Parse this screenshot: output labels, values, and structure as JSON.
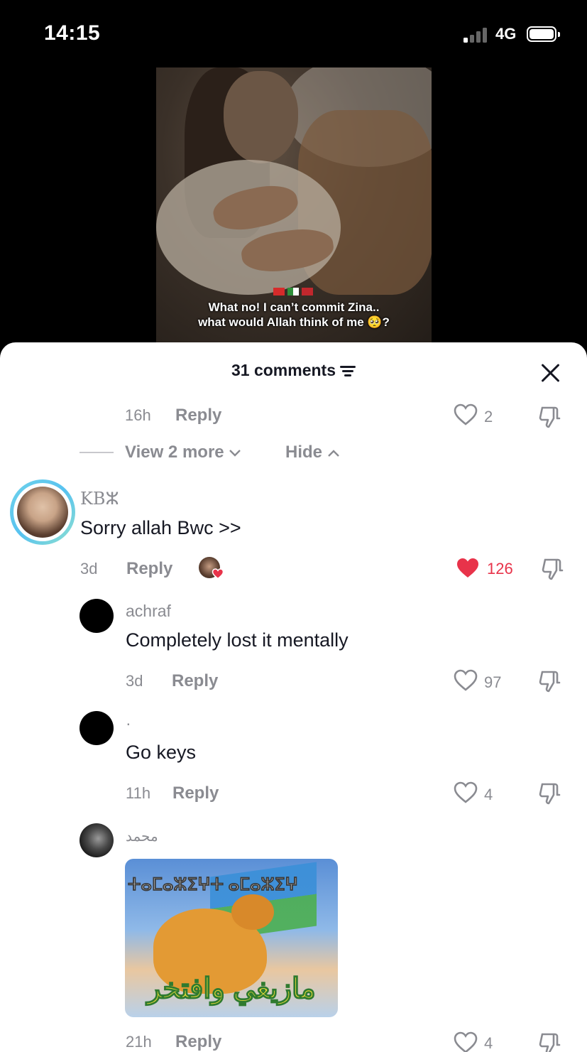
{
  "status_bar": {
    "time": "14:15",
    "network": "4G"
  },
  "video": {
    "caption_line1": "What no! I can’t commit Zina..",
    "caption_line2": "what would Allah think of me 🥺?"
  },
  "sheet": {
    "title": "31 comments"
  },
  "thread0": {
    "time": "16h",
    "reply": "Reply",
    "likes": "2",
    "view_more": "View 2 more",
    "hide": "Hide"
  },
  "comments": [
    {
      "username": "KBⵣ",
      "text": "Sorry allah Bwc >>",
      "time": "3d",
      "reply": "Reply",
      "likes": "126",
      "liked": true
    },
    {
      "username": "achraf",
      "text": "Completely lost it mentally",
      "time": "3d",
      "reply": "Reply",
      "likes": "97"
    },
    {
      "username": "·",
      "text": "Go keys",
      "time": "11h",
      "reply": "Reply",
      "likes": "4"
    },
    {
      "username": "محمد",
      "time": "21h",
      "reply": "Reply",
      "likes": "4",
      "gif": {
        "top_text": "ⵜⴰⵎⴰⵣⵉⵖⵜ ⴰⵎⴰⵣⵉⵖ",
        "bottom_text": "مازيغي وافتخر"
      }
    }
  ],
  "colors": {
    "like_red": "#e8334a",
    "muted": "#8a8b91",
    "text": "#161823",
    "ring_start": "#6fd2ea",
    "ring_end": "#57c2f0"
  },
  "icons": [
    "heart-icon",
    "dislike-icon",
    "close-icon",
    "filter-icon",
    "chevron-down-icon",
    "chevron-up-icon"
  ]
}
